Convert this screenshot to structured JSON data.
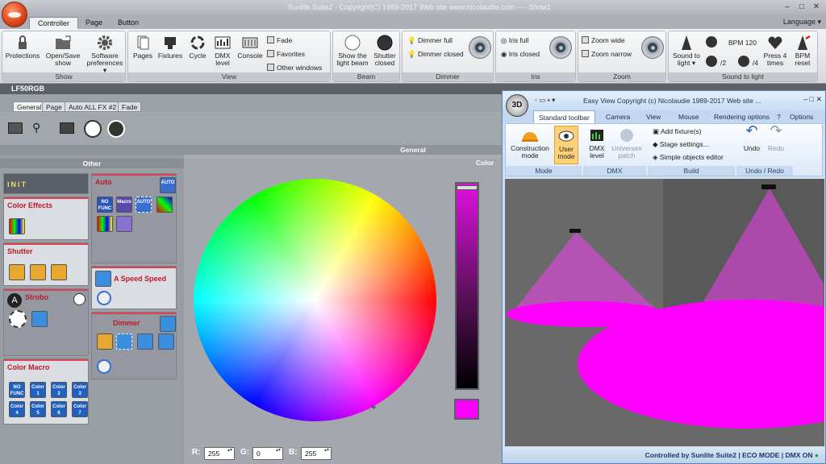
{
  "app": {
    "title": "Sunlite Suite2 - Copyright(C) 1989-2017    Web site www.nicolaudie.com ---- Show1",
    "language": "Language"
  },
  "tabs": [
    "Controller",
    "Page",
    "Button"
  ],
  "ribbon": {
    "show": {
      "label": "Show",
      "protections": "Protections",
      "open_save": "Open/Save show",
      "prefs": "Software preferences"
    },
    "view": {
      "label": "View",
      "pages": "Pages",
      "fixtures": "Fixtures",
      "cycle": "Cycle",
      "dmx": "DMX level",
      "console": "Console",
      "fade": "Fade",
      "favorites": "Favorites",
      "other": "Other windows"
    },
    "beam": {
      "label": "Beam",
      "show": "Show the light beam",
      "shutter": "Shutter closed"
    },
    "dimmer": {
      "label": "Dimmer",
      "full": "Dimmer full",
      "closed": "Dimmer closed"
    },
    "iris": {
      "label": "Iris",
      "full": "Iris full",
      "closed": "Iris closed"
    },
    "zoom": {
      "label": "Zoom",
      "wide": "Zoom wide",
      "narrow": "Zoom narrow"
    },
    "stl": {
      "label": "Sound to light",
      "sound": "Sound to light",
      "bpm": "BPM 120",
      "div2": "/2",
      "div4": "/4",
      "press": "Press 4 times",
      "reset": "BPM reset"
    }
  },
  "fixture": {
    "name": "LF50RGB"
  },
  "subtabs": [
    "General",
    "Page",
    "Auto ALL FX #2",
    "Fade"
  ],
  "general_label": "General",
  "other_label": "Other",
  "color_label": "Color",
  "boxes": {
    "init": "INIT",
    "color_effects": "Color Effects",
    "shutter": "Shutter",
    "strobo": "Strobo",
    "color_macro": "Color Macro",
    "auto": "Auto",
    "speed": "A Speed Speed",
    "dimmer": "Dimmer"
  },
  "auto_icons": [
    "AUTO",
    "NO FUNC",
    "Macro",
    "AUTO"
  ],
  "macro_icons": [
    "NO FUNC",
    "Color 1",
    "Color 2",
    "Color 3",
    "Color 4",
    "Color 5",
    "Color 6",
    "Color 7"
  ],
  "rgb": {
    "r_label": "R:",
    "r": "255",
    "g_label": "G:",
    "g": "0",
    "b_label": "B:",
    "b": "255"
  },
  "colors": {
    "selected": "#ff00ff",
    "accent": "#c0192b"
  },
  "easyview": {
    "title": "Easy View   Copyright (c) Nicolaudie 1989-2017   Web site ...",
    "orb": "3D",
    "tabs": [
      "Standard toolbar",
      "Camera",
      "View",
      "Mouse",
      "Rendering options",
      "?",
      "Options"
    ],
    "mode": {
      "label": "Mode",
      "construction": "Construction mode",
      "user": "User mode"
    },
    "dmx": {
      "label": "DMX",
      "level": "DMX level",
      "patch": "Universes patch"
    },
    "build": {
      "label": "Build",
      "add": "Add fixture(s)",
      "stage": "Stage settings...",
      "simple": "Simple objects editor"
    },
    "undo": {
      "label": "Undo / Redo",
      "undo": "Undo",
      "redo": "Redo"
    },
    "status": "Controlled by Sunlite Suite2  |  ECO MODE  |  DMX ON"
  }
}
